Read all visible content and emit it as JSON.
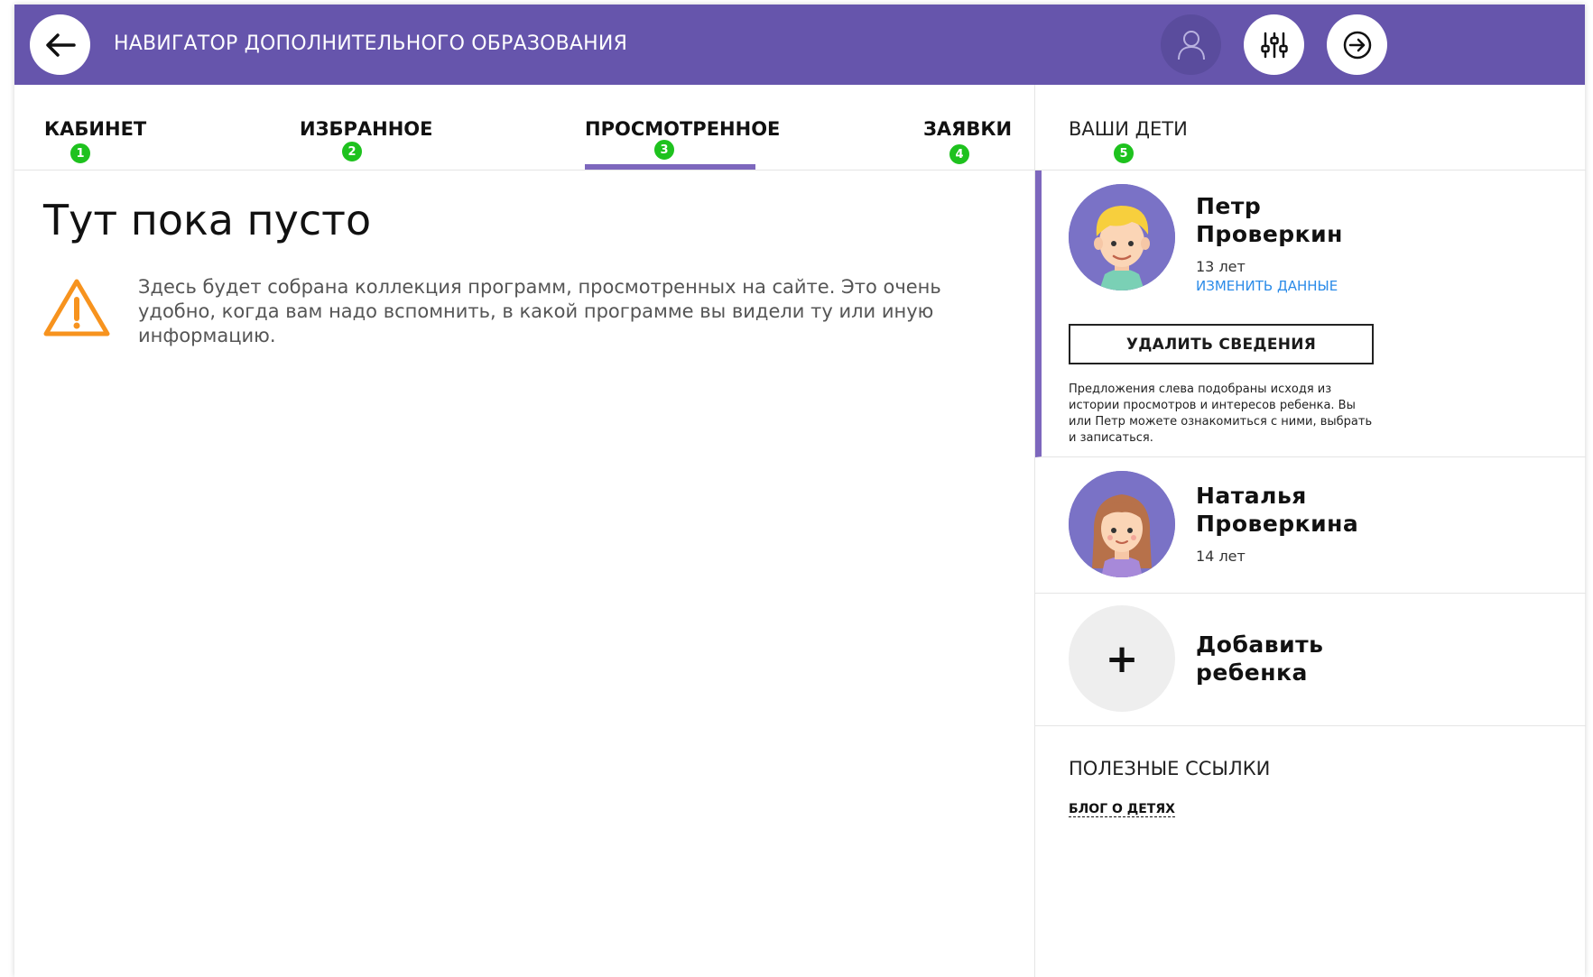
{
  "header": {
    "title": "НАВИГАТОР ДОПОЛНИТЕЛЬНОГО ОБРАЗОВАНИЯ",
    "back_icon": "arrow-left-icon",
    "profile_icon": "user-icon",
    "filters_icon": "sliders-icon",
    "logout_icon": "logout-arrow-icon"
  },
  "tabs": [
    {
      "label": "КАБИНЕТ",
      "num": "1"
    },
    {
      "label": "ИЗБРАННОЕ",
      "num": "2"
    },
    {
      "label": "ПРОСМОТРЕННОЕ",
      "num": "3",
      "active": true
    },
    {
      "label": "ЗАЯВКИ",
      "num": "4"
    }
  ],
  "main": {
    "empty_title": "Тут пока пусто",
    "empty_text": "Здесь будет собрана коллекция программ, просмотренных на сайте. Это очень удобно, когда вам надо вспомнить, в какой программе вы видели ту или иную информацию.",
    "warning_icon": "warning-triangle-icon"
  },
  "kids": {
    "title": "ВАШИ ДЕТИ",
    "num": "5",
    "children": [
      {
        "first_name": "Петр",
        "last_name": "Проверкин",
        "age": "13 лет",
        "edit_label": "ИЗМЕНИТЬ ДАННЫЕ",
        "delete_label": "УДАЛИТЬ СВЕДЕНИЯ",
        "hint": "Предложения слева подобраны исходя из истории просмотров и интересов ребенка. Вы или Петр можете ознакомиться с ними, выбрать и записаться."
      },
      {
        "first_name": "Наталья",
        "last_name": "Проверкина",
        "age": "14 лет"
      }
    ],
    "add_label_1": "Добавить",
    "add_label_2": "ребенка",
    "add_symbol": "+"
  },
  "links": {
    "title": "ПОЛЕЗНЫЕ ССЫЛКИ",
    "blog": "БЛОГ О ДЕТЯХ"
  },
  "colors": {
    "header_bg": "#6655ac",
    "accent": "#7d67bd",
    "badge": "#1ec21e",
    "warning": "#f7931e",
    "link": "#2b8be8"
  }
}
